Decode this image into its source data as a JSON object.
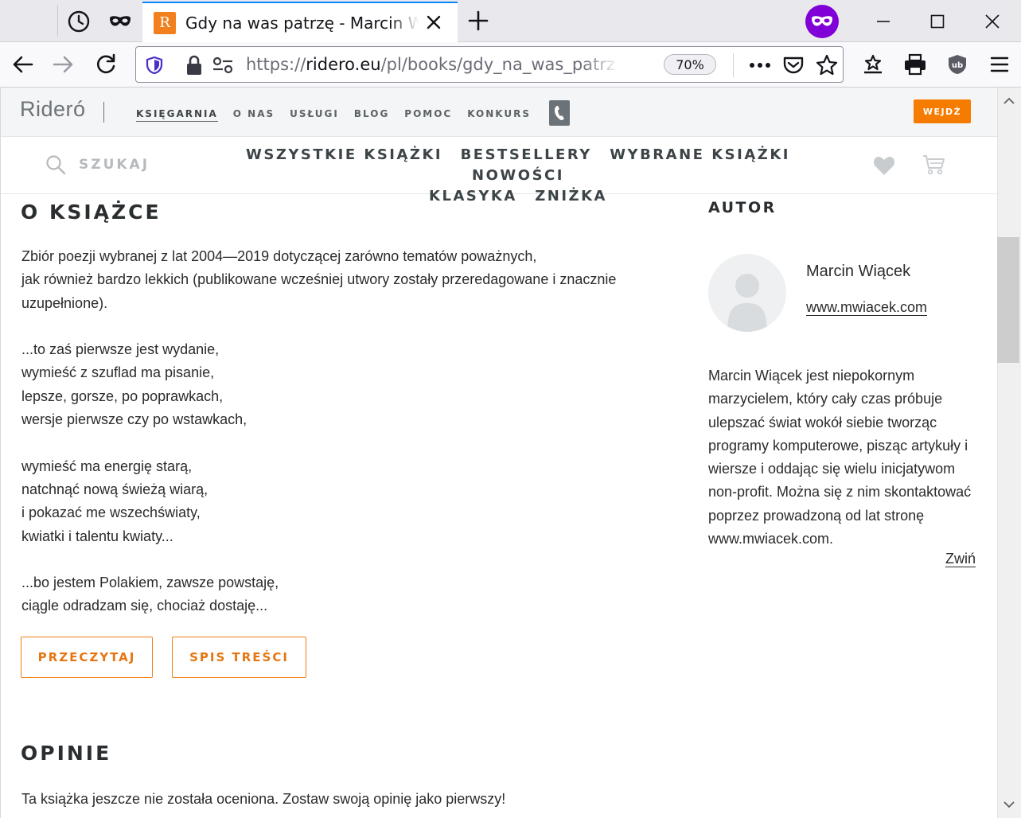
{
  "browser": {
    "tab_title": "Gdy na was patrzę - Marcin Wiącek",
    "favicon_letter": "R",
    "url_prefix": "https://",
    "url_host": "ridero.eu",
    "url_path": "/pl/books/gdy_na_was_patrz",
    "zoom": "70%"
  },
  "site": {
    "logo": "Rideró",
    "top_nav": [
      "KSIĘGARNIA",
      "O NAS",
      "USŁUGI",
      "BLOG",
      "POMOC",
      "KONKURS"
    ],
    "login_label": "WEJDŹ",
    "search_label": "SZUKAJ",
    "category_nav": [
      "WSZYSTKIE KSIĄŻKI",
      "BESTSELLERY",
      "WYBRANE KSIĄŻKI",
      "NOWOŚCI",
      "KLASYKA",
      "ZNIŻKA"
    ]
  },
  "about": {
    "title": "O KSIĄŻCE",
    "lines": [
      "Zbiór poezji wybranej z lat 2004—2019 dotyczącej zarówno tematów poważnych,",
      "jak również bardzo lekkich (publikowane wcześniej utwory zostały przeredagowane i znacznie uzupełnione).",
      "",
      "...to zaś pierwsze jest wydanie,",
      "wymieść z szuflad ma pisanie,",
      "lepsze, gorsze, po poprawkach,",
      "wersje pierwsze czy po wstawkach,",
      "",
      "wymieść ma energię starą,",
      "natchnąć nową świeżą wiarą,",
      "i pokazać me wszechświaty,",
      "kwiatki i talentu kwiaty...",
      "",
      "...bo jestem Polakiem, zawsze powstaję,",
      "ciągle odradzam się, chociaż dostaję..."
    ],
    "read_button": "PRZECZYTAJ",
    "toc_button": "SPIS TREŚCI"
  },
  "opinions": {
    "title": "OPINIE",
    "empty_text": "Ta książka jeszcze nie została oceniona. Zostaw swoją opinię jako pierwszy!"
  },
  "author": {
    "title": "AUTOR",
    "name": "Marcin Wiącek",
    "website": "www.mwiacek.com",
    "bio": "Marcin Wiącek jest niepokornym marzycielem, który cały czas próbuje ulepszać świat wokół siebie tworząc programy komputerowe, pisząc artykuły i wiersze i oddając się wielu inicjatywom non-profit. Można się z nim skontaktować poprzez prowadzoną od lat stronę www.mwiacek.com.",
    "collapse_label": "Zwiń"
  },
  "colors": {
    "accent": "#f57c00",
    "private_badge": "#8000d7",
    "tab_highlight": "#0a84ff"
  }
}
